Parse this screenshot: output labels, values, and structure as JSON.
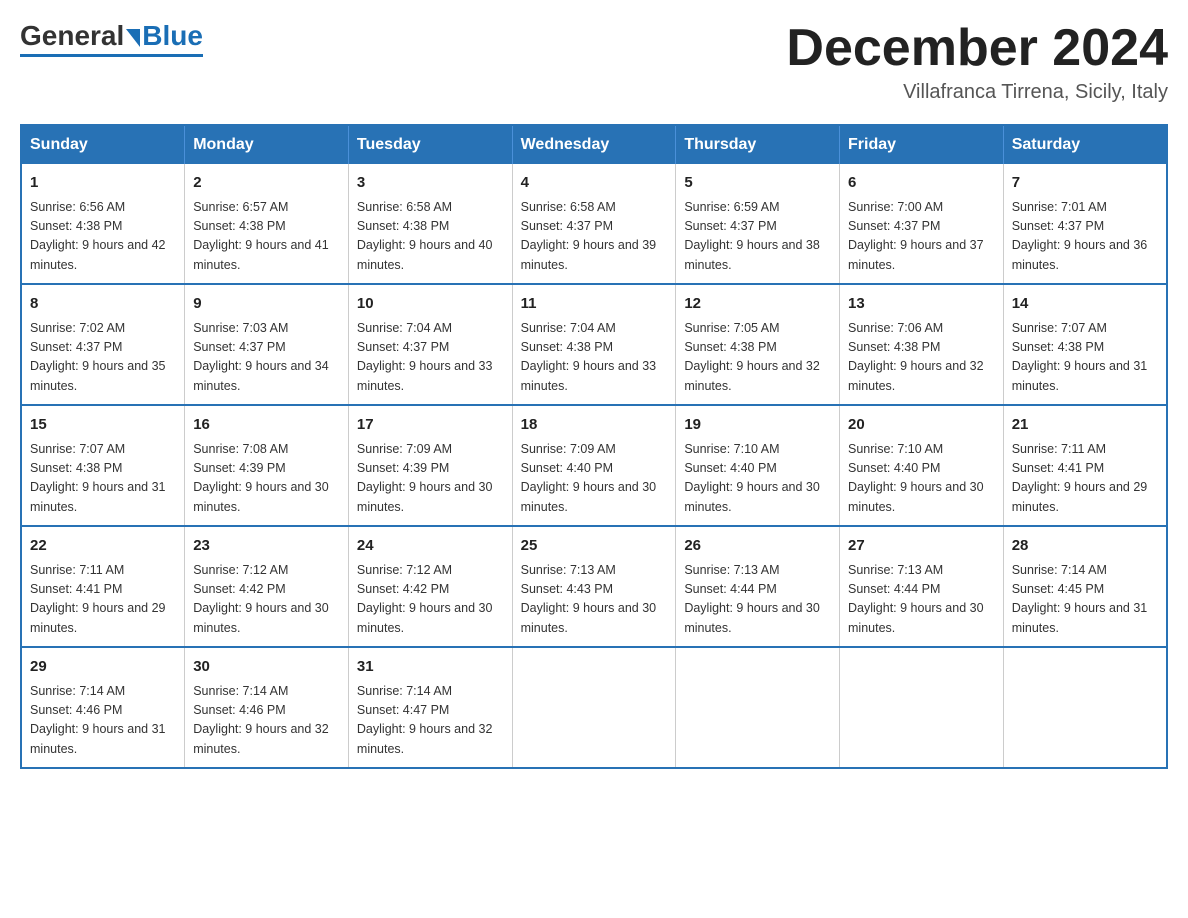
{
  "header": {
    "logo_general": "General",
    "logo_blue": "Blue",
    "month_title": "December 2024",
    "location": "Villafranca Tirrena, Sicily, Italy"
  },
  "weekdays": [
    "Sunday",
    "Monday",
    "Tuesday",
    "Wednesday",
    "Thursday",
    "Friday",
    "Saturday"
  ],
  "weeks": [
    [
      {
        "day": "1",
        "sunrise": "6:56 AM",
        "sunset": "4:38 PM",
        "daylight": "9 hours and 42 minutes."
      },
      {
        "day": "2",
        "sunrise": "6:57 AM",
        "sunset": "4:38 PM",
        "daylight": "9 hours and 41 minutes."
      },
      {
        "day": "3",
        "sunrise": "6:58 AM",
        "sunset": "4:38 PM",
        "daylight": "9 hours and 40 minutes."
      },
      {
        "day": "4",
        "sunrise": "6:58 AM",
        "sunset": "4:37 PM",
        "daylight": "9 hours and 39 minutes."
      },
      {
        "day": "5",
        "sunrise": "6:59 AM",
        "sunset": "4:37 PM",
        "daylight": "9 hours and 38 minutes."
      },
      {
        "day": "6",
        "sunrise": "7:00 AM",
        "sunset": "4:37 PM",
        "daylight": "9 hours and 37 minutes."
      },
      {
        "day": "7",
        "sunrise": "7:01 AM",
        "sunset": "4:37 PM",
        "daylight": "9 hours and 36 minutes."
      }
    ],
    [
      {
        "day": "8",
        "sunrise": "7:02 AM",
        "sunset": "4:37 PM",
        "daylight": "9 hours and 35 minutes."
      },
      {
        "day": "9",
        "sunrise": "7:03 AM",
        "sunset": "4:37 PM",
        "daylight": "9 hours and 34 minutes."
      },
      {
        "day": "10",
        "sunrise": "7:04 AM",
        "sunset": "4:37 PM",
        "daylight": "9 hours and 33 minutes."
      },
      {
        "day": "11",
        "sunrise": "7:04 AM",
        "sunset": "4:38 PM",
        "daylight": "9 hours and 33 minutes."
      },
      {
        "day": "12",
        "sunrise": "7:05 AM",
        "sunset": "4:38 PM",
        "daylight": "9 hours and 32 minutes."
      },
      {
        "day": "13",
        "sunrise": "7:06 AM",
        "sunset": "4:38 PM",
        "daylight": "9 hours and 32 minutes."
      },
      {
        "day": "14",
        "sunrise": "7:07 AM",
        "sunset": "4:38 PM",
        "daylight": "9 hours and 31 minutes."
      }
    ],
    [
      {
        "day": "15",
        "sunrise": "7:07 AM",
        "sunset": "4:38 PM",
        "daylight": "9 hours and 31 minutes."
      },
      {
        "day": "16",
        "sunrise": "7:08 AM",
        "sunset": "4:39 PM",
        "daylight": "9 hours and 30 minutes."
      },
      {
        "day": "17",
        "sunrise": "7:09 AM",
        "sunset": "4:39 PM",
        "daylight": "9 hours and 30 minutes."
      },
      {
        "day": "18",
        "sunrise": "7:09 AM",
        "sunset": "4:40 PM",
        "daylight": "9 hours and 30 minutes."
      },
      {
        "day": "19",
        "sunrise": "7:10 AM",
        "sunset": "4:40 PM",
        "daylight": "9 hours and 30 minutes."
      },
      {
        "day": "20",
        "sunrise": "7:10 AM",
        "sunset": "4:40 PM",
        "daylight": "9 hours and 30 minutes."
      },
      {
        "day": "21",
        "sunrise": "7:11 AM",
        "sunset": "4:41 PM",
        "daylight": "9 hours and 29 minutes."
      }
    ],
    [
      {
        "day": "22",
        "sunrise": "7:11 AM",
        "sunset": "4:41 PM",
        "daylight": "9 hours and 29 minutes."
      },
      {
        "day": "23",
        "sunrise": "7:12 AM",
        "sunset": "4:42 PM",
        "daylight": "9 hours and 30 minutes."
      },
      {
        "day": "24",
        "sunrise": "7:12 AM",
        "sunset": "4:42 PM",
        "daylight": "9 hours and 30 minutes."
      },
      {
        "day": "25",
        "sunrise": "7:13 AM",
        "sunset": "4:43 PM",
        "daylight": "9 hours and 30 minutes."
      },
      {
        "day": "26",
        "sunrise": "7:13 AM",
        "sunset": "4:44 PM",
        "daylight": "9 hours and 30 minutes."
      },
      {
        "day": "27",
        "sunrise": "7:13 AM",
        "sunset": "4:44 PM",
        "daylight": "9 hours and 30 minutes."
      },
      {
        "day": "28",
        "sunrise": "7:14 AM",
        "sunset": "4:45 PM",
        "daylight": "9 hours and 31 minutes."
      }
    ],
    [
      {
        "day": "29",
        "sunrise": "7:14 AM",
        "sunset": "4:46 PM",
        "daylight": "9 hours and 31 minutes."
      },
      {
        "day": "30",
        "sunrise": "7:14 AM",
        "sunset": "4:46 PM",
        "daylight": "9 hours and 32 minutes."
      },
      {
        "day": "31",
        "sunrise": "7:14 AM",
        "sunset": "4:47 PM",
        "daylight": "9 hours and 32 minutes."
      },
      null,
      null,
      null,
      null
    ]
  ]
}
